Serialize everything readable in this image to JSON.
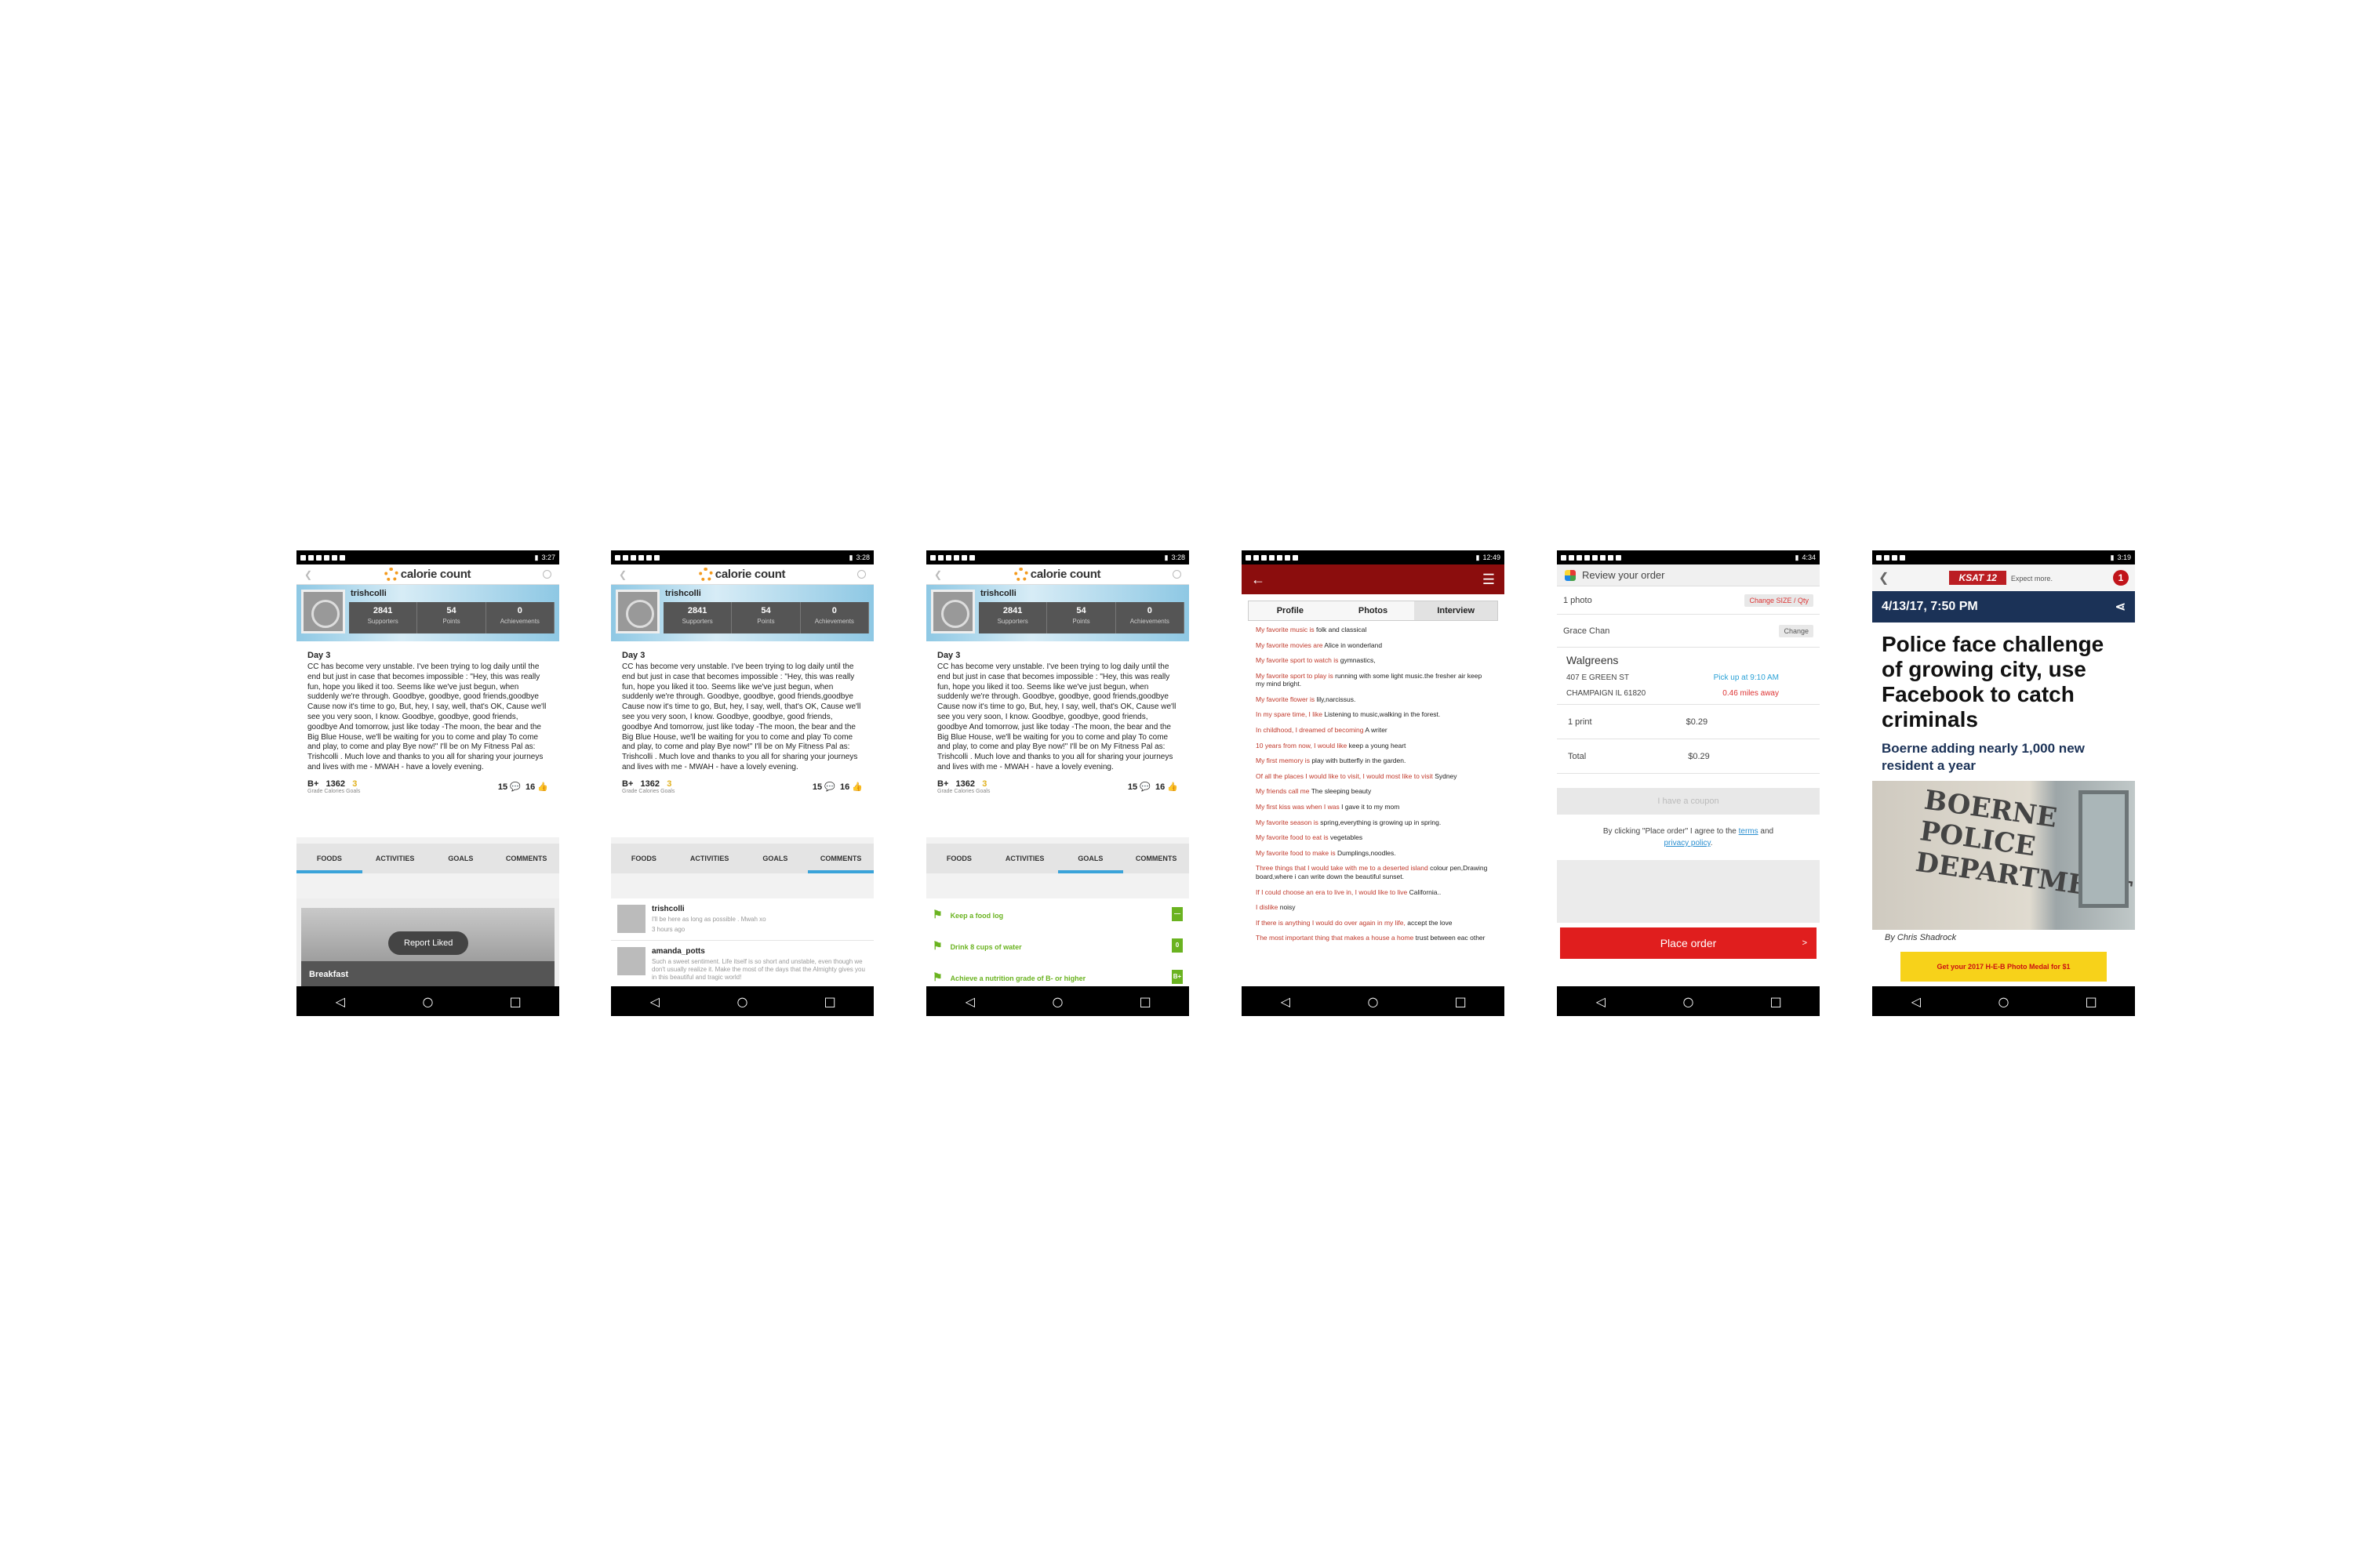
{
  "status_times": [
    "3:27",
    "3:28",
    "3:28",
    "12:49",
    "4:34",
    "3:19"
  ],
  "calorie": {
    "logo": "calorie count",
    "username": "trishcolli",
    "stats": [
      {
        "value": "2841",
        "label": "Supporters"
      },
      {
        "value": "54",
        "label": "Points"
      },
      {
        "value": "0",
        "label": "Achievements"
      }
    ],
    "post_title": "Day 3",
    "post_body": "CC has become very unstable. I've been trying to log daily until the end but just in case that becomes impossible : \"Hey, this was really fun, hope you liked it too. Seems like we've just begun, when suddenly we're through. Goodbye, goodbye, good friends,goodbye Cause now it's time to go, But, hey, I say, well, that's OK, Cause we'll see you very soon, I know. Goodbye, goodbye, good friends, goodbye And tomorrow, just like today -The moon, the bear and the Big Blue House, we'll be waiting for you to come and play To come and play, to come and play Bye now!\" I'll be on My Fitness Pal as: Trishcolli . Much love and thanks to you all for sharing your journeys and lives with me - MWAH - have a lovely evening.",
    "grade": "B+",
    "calories": "1362",
    "goals": "3",
    "meta_labels": [
      "Grade",
      "Calories",
      "Goals"
    ],
    "comments_count": "15",
    "likes_count": "16",
    "tabs": [
      "FOODS",
      "ACTIVITIES",
      "GOALS",
      "COMMENTS"
    ],
    "toast": "Report Liked",
    "breakfast": "Breakfast",
    "comments": [
      {
        "user": "trishcolli",
        "text": "I'll be here as long as possible . Mwah xo",
        "time": "3 hours ago"
      },
      {
        "user": "amanda_potts",
        "text": "Such a sweet sentiment. Life itself is so short and unstable, even though we don't usually realize it. Make the most of the days that the Almighty gives you in this beautiful and tragic world!",
        "time": ""
      }
    ],
    "goals_list": [
      "Keep a food log",
      "Drink 8 cups of water",
      "Achieve a nutrition grade of B- or higher"
    ],
    "goal_marks": [
      "—",
      "0",
      "B+"
    ]
  },
  "interview": {
    "tabs": [
      "Profile",
      "Photos",
      "Interview"
    ],
    "qa": [
      {
        "q": "My favorite music is",
        "a": "folk and classical"
      },
      {
        "q": "My favorite movies are",
        "a": "Alice in wonderland"
      },
      {
        "q": "My favorite sport to watch is",
        "a": "gymnastics,"
      },
      {
        "q": "My favorite sport to play is",
        "a": "running with some light music.the fresher air keep my mind bright."
      },
      {
        "q": "My favorite flower is",
        "a": "lily,narcissus."
      },
      {
        "q": "In my spare time, I like",
        "a": "Listening to music,walking in the forest."
      },
      {
        "q": "In childhood, I dreamed of becoming",
        "a": "A writer"
      },
      {
        "q": "10 years from now, I would like",
        "a": "keep a young heart"
      },
      {
        "q": "My first memory is",
        "a": "play with butterfly in the garden."
      },
      {
        "q": "Of all the places I would like to visit, I would most like to visit",
        "a": "Sydney"
      },
      {
        "q": "My friends call me",
        "a": "The sleeping beauty"
      },
      {
        "q": "My first kiss was when I was",
        "a": "I gave it to my mom"
      },
      {
        "q": "My favorite season is",
        "a": "spring,everything is growing up in spring."
      },
      {
        "q": "My favorite food to eat is",
        "a": "vegetables"
      },
      {
        "q": "My favorite food to make is",
        "a": "Dumplings,noodles."
      },
      {
        "q": "Three things that I would take with me to a deserted island",
        "a": "colour pen,Drawing board,where i can write down the beautiful sunset."
      },
      {
        "q": "If I could choose an era to live in, I would like to live",
        "a": "California.."
      },
      {
        "q": "I dislike",
        "a": "noisy"
      },
      {
        "q": "If there is anything I would do over again in my life,",
        "a": "accept the love"
      },
      {
        "q": "The most important thing that makes a house a home",
        "a": "trust between eac other"
      }
    ]
  },
  "walgreens": {
    "header": "Review your order",
    "photo_count": "1 photo",
    "change_size": "Change SIZE / Qty",
    "customer": "Grace Chan",
    "change": "Change",
    "store": "Walgreens",
    "address1": "407 E GREEN ST",
    "address2": "CHAMPAIGN IL 61820",
    "pickup": "Pick up at 9:10 AM",
    "distance": "0.46 miles away",
    "print_label": "1 print",
    "print_price": "$0.29",
    "total_label": "Total",
    "total_price": "$0.29",
    "coupon": "I have a coupon",
    "agree_prefix": "By clicking \"Place order\" I agree to the",
    "terms": "terms",
    "and": "and",
    "privacy": "privacy policy",
    "place_order": "Place order",
    "place_arrow": ">"
  },
  "news": {
    "station": "KSAT 12",
    "tagline": "Expect more.",
    "badge": "1",
    "date": "4/13/17, 7:50 PM",
    "headline": "Police face challenge of growing city, use Facebook to catch criminals",
    "subhead": "Boerne adding nearly 1,000 new resident a year",
    "photo_sign": "BOERNE POLICE DEPARTMENT",
    "byline": "By Chris Shadrock",
    "ad_text": "Get your 2017 H-E-B Photo Medal for $1"
  }
}
